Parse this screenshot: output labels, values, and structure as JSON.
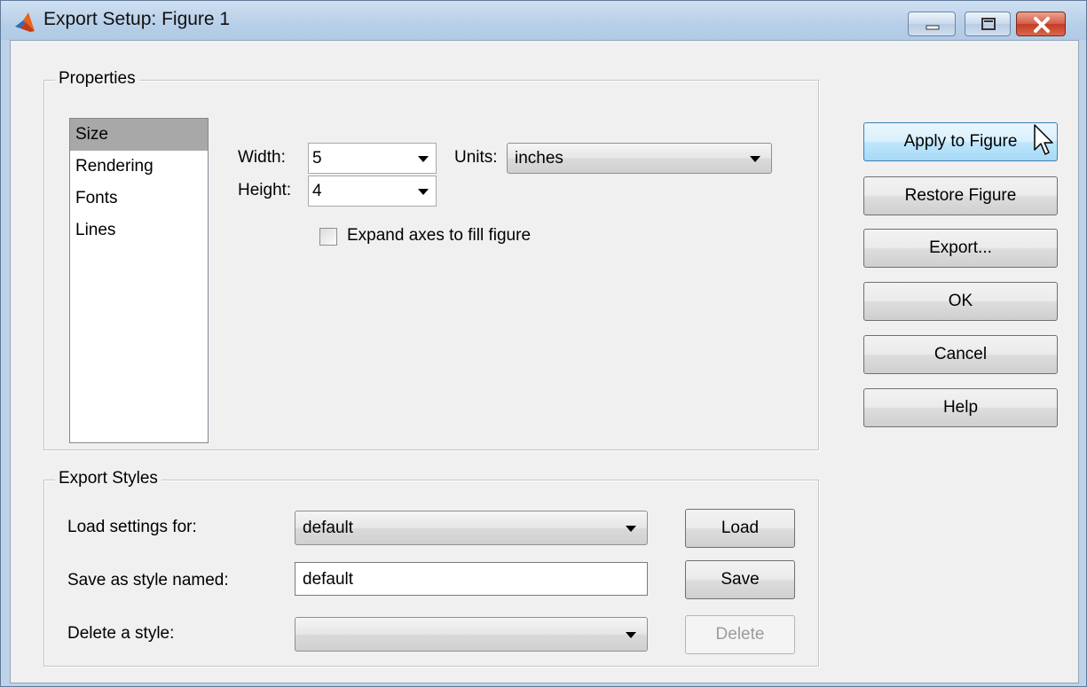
{
  "window": {
    "title": "Export Setup: Figure 1"
  },
  "properties": {
    "group_title": "Properties",
    "items": [
      {
        "label": "Size",
        "selected": true
      },
      {
        "label": "Rendering",
        "selected": false
      },
      {
        "label": "Fonts",
        "selected": false
      },
      {
        "label": "Lines",
        "selected": false
      }
    ],
    "width_label": "Width:",
    "width_value": "5",
    "units_label": "Units:",
    "units_value": "inches",
    "height_label": "Height:",
    "height_value": "4",
    "expand_label": "Expand axes to fill figure",
    "expand_checked": false
  },
  "buttons": {
    "apply": "Apply to Figure",
    "restore": "Restore Figure",
    "export": "Export...",
    "ok": "OK",
    "cancel": "Cancel",
    "help": "Help"
  },
  "export_styles": {
    "group_title": "Export Styles",
    "load_label": "Load settings for:",
    "load_value": "default",
    "load_button": "Load",
    "save_label": "Save as style named:",
    "save_value": "default",
    "save_button": "Save",
    "delete_label": "Delete a style:",
    "delete_value": "",
    "delete_button": "Delete"
  },
  "colors": {
    "title_bar": "#b7cfe8",
    "close_button": "#c53b22",
    "selection": "#a8a8a8",
    "dialog_bg": "#f0f0f0"
  }
}
